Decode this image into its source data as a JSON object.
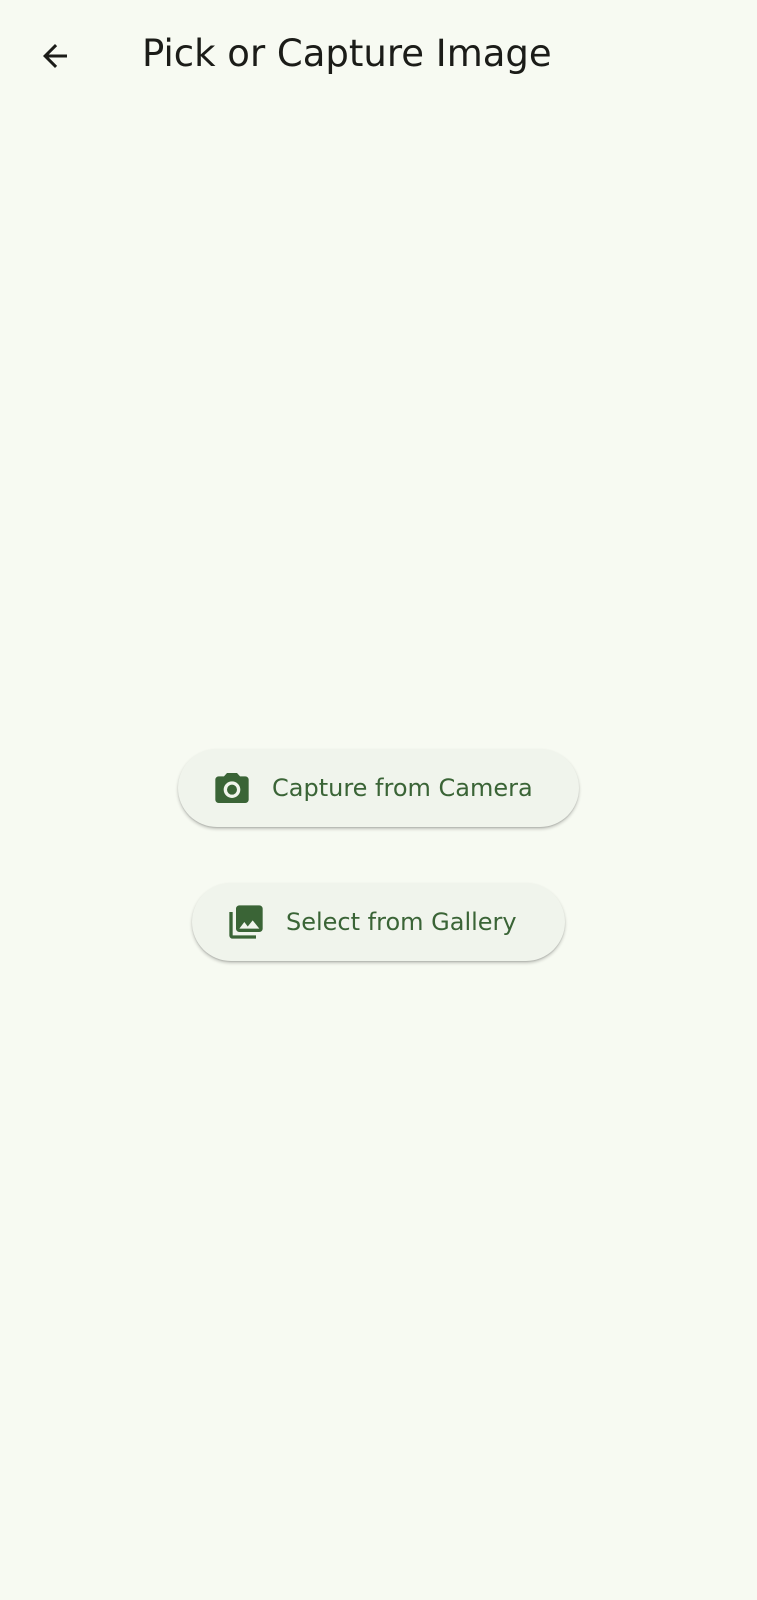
{
  "app_bar": {
    "title": "Pick or Capture Image",
    "back_icon": "arrow-left-icon"
  },
  "actions": {
    "camera": {
      "label": "Capture from Camera",
      "icon": "camera-icon"
    },
    "gallery": {
      "label": "Select from Gallery",
      "icon": "photo-library-icon"
    }
  },
  "colors": {
    "background": "#f7faf2",
    "button_surface": "#f0f4ec",
    "accent": "#3a6436",
    "title_text": "#1b1c18"
  }
}
